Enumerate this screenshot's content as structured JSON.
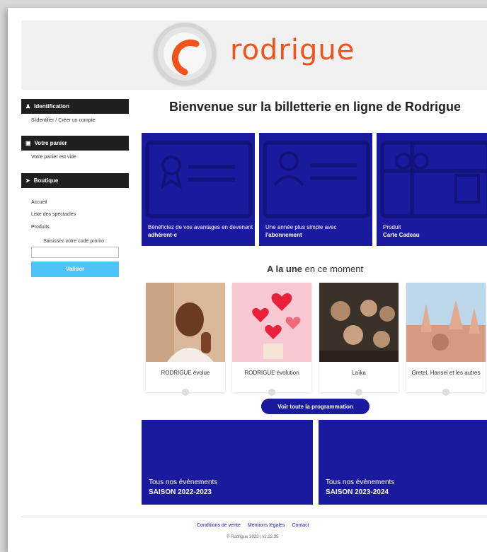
{
  "brand": {
    "name": "rodrigue",
    "accent": "#f0531c",
    "primary": "#1a1a9e",
    "button_light": "#4fc3f7"
  },
  "sidebar": {
    "identification": {
      "title": "Identification",
      "link": "S'identifier / Créer un compte"
    },
    "panier": {
      "title": "Votre panier",
      "status": "Votre panier est vide"
    },
    "boutique": {
      "title": "Boutique",
      "items": [
        "Accueil",
        "Liste des spectacles",
        "Produits"
      ]
    },
    "promo": {
      "label": "Saisissez votre code promo :",
      "placeholder": "",
      "button": "Valider"
    }
  },
  "main": {
    "welcome": "Bienvenue sur la billetterie en ligne de Rodrigue",
    "cards": [
      {
        "text": "Bénéficiez de vos avantages en devenant ",
        "bold": "adhérent·e",
        "icon": "membership-card-icon"
      },
      {
        "text": "Une année plus simple avec ",
        "bold": "l'abonnement",
        "icon": "id-card-icon"
      },
      {
        "text": "Produit",
        "bold": "Carte Cadeau",
        "icon": "gift-card-icon"
      }
    ],
    "une": {
      "bold": "A la une",
      "rest": " en ce moment"
    },
    "events": [
      {
        "title": "RODRIGUE évolue"
      },
      {
        "title": "RODRIGUE évolution"
      },
      {
        "title": "Laïka"
      },
      {
        "title": "Gretel, Hansel et les autres"
      }
    ],
    "program_button": "Voir toute la programmation",
    "seasons": [
      {
        "line1": "Tous nos évènements",
        "line2": "SAISON 2022-2023"
      },
      {
        "line1": "Tous nos évènements",
        "line2": "SAISON 2023-2024"
      }
    ]
  },
  "footer": {
    "links": [
      "Conditions de vente",
      "Mentions légales",
      "Contact"
    ],
    "copyright": "© Rodrigue 2023 | v2.22.35"
  }
}
